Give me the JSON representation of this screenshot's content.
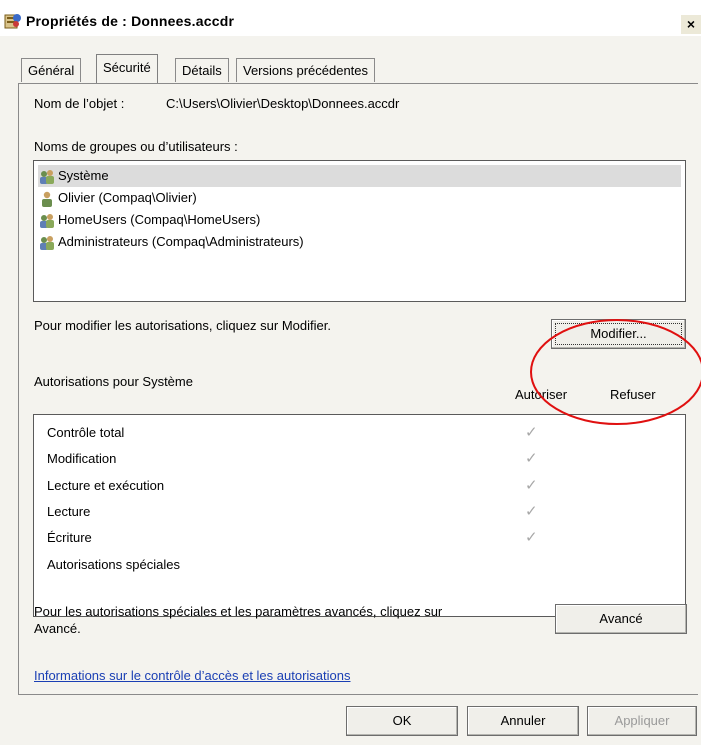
{
  "window": {
    "title": "Propriétés de : Donnees.accdr",
    "close_label": "×"
  },
  "tabs": [
    {
      "label": "Général",
      "active": false
    },
    {
      "label": "Sécurité",
      "active": true
    },
    {
      "label": "Détails",
      "active": false
    },
    {
      "label": "Versions précédentes",
      "active": false
    }
  ],
  "object": {
    "label": "Nom de l’objet :",
    "value": "C:\\Users\\Olivier\\Desktop\\Donnees.accdr"
  },
  "groups": {
    "label": "Noms de groupes ou d’utilisateurs :",
    "items": [
      {
        "label": "Système",
        "icon": "group-users-icon",
        "selected": true
      },
      {
        "label": "Olivier (Compaq\\Olivier)",
        "icon": "user-icon",
        "selected": false
      },
      {
        "label": "HomeUsers (Compaq\\HomeUsers)",
        "icon": "group-users-icon",
        "selected": false
      },
      {
        "label": "Administrateurs (Compaq\\Administrateurs)",
        "icon": "group-users-icon",
        "selected": false
      }
    ]
  },
  "modify": {
    "hint": "Pour modifier les autorisations, cliquez sur Modifier.",
    "button_label": "Modifier..."
  },
  "permissions": {
    "title": "Autorisations pour Système",
    "allow_header": "Autoriser",
    "deny_header": "Refuser",
    "rows": [
      {
        "label": "Contrôle total",
        "allow": true,
        "deny": false
      },
      {
        "label": "Modification",
        "allow": true,
        "deny": false
      },
      {
        "label": "Lecture et exécution",
        "allow": true,
        "deny": false
      },
      {
        "label": "Lecture",
        "allow": true,
        "deny": false
      },
      {
        "label": "Écriture",
        "allow": true,
        "deny": false
      },
      {
        "label": "Autorisations spéciales",
        "allow": false,
        "deny": false
      }
    ],
    "check_glyph": "✓"
  },
  "advanced": {
    "hint_line1": "Pour les autorisations spéciales et les paramètres avancés, cliquez sur",
    "hint_line2": "Avancé.",
    "button_label": "Avancé"
  },
  "link_text": "Informations sur le contrôle d’accès et les autorisations",
  "footer": {
    "ok": "OK",
    "cancel": "Annuler",
    "apply": "Appliquer"
  },
  "colors": {
    "link": "#1a3fb4",
    "annotation_circle": "#e01010"
  }
}
